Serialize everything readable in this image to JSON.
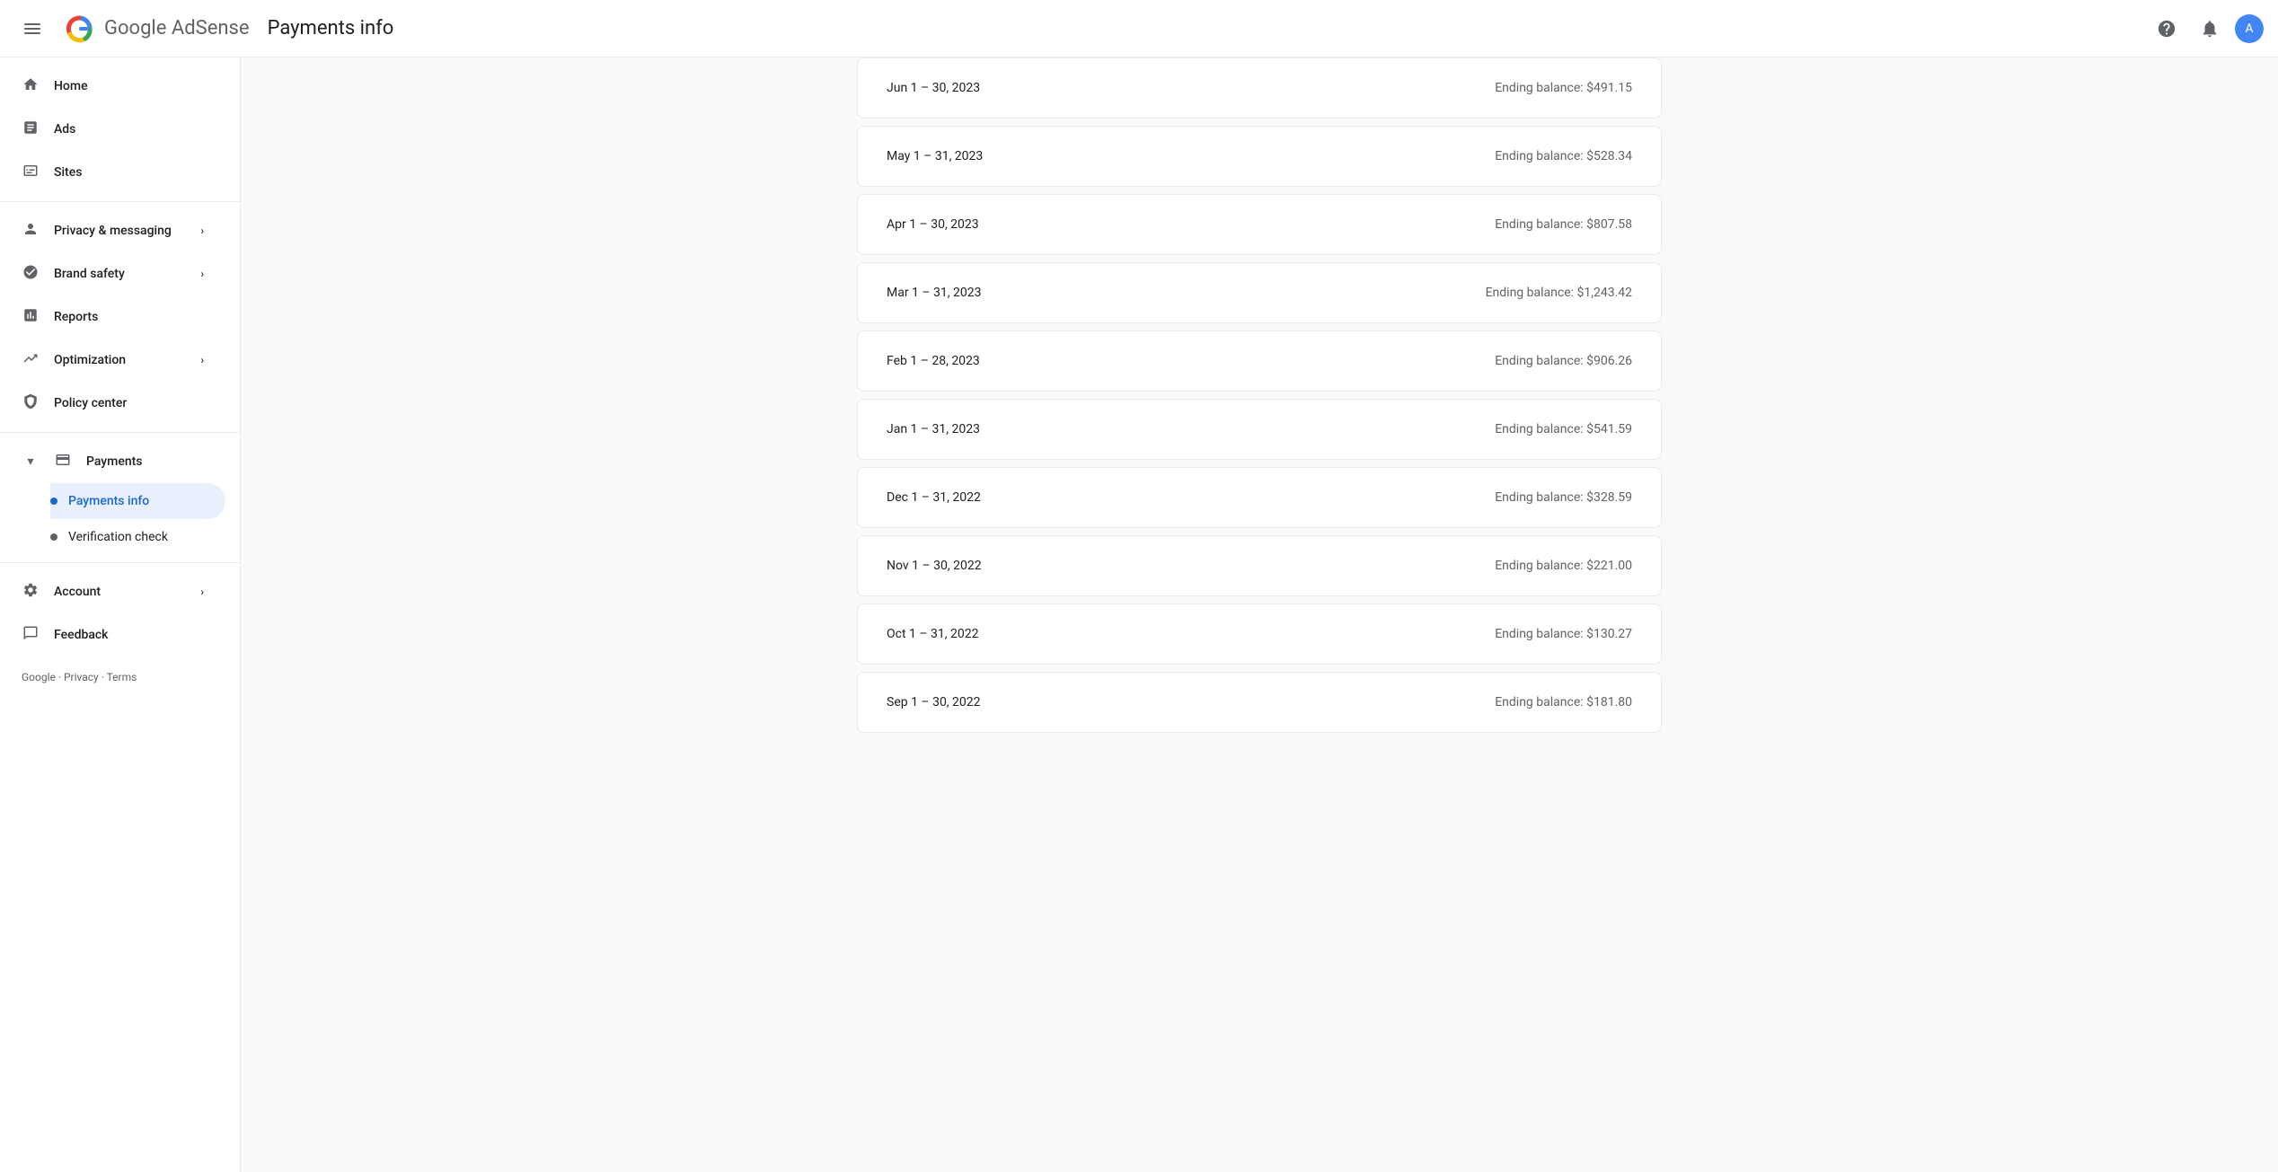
{
  "topbar": {
    "page_title": "Payments info",
    "help_icon": "?",
    "notifications_icon": "🔔",
    "avatar_initials": "A"
  },
  "sidebar": {
    "logo_text": "Google AdSense",
    "items": [
      {
        "id": "home",
        "label": "Home",
        "icon": "home",
        "active": false
      },
      {
        "id": "ads",
        "label": "Ads",
        "icon": "ads",
        "active": false
      },
      {
        "id": "sites",
        "label": "Sites",
        "icon": "sites",
        "active": false
      },
      {
        "id": "privacy-messaging",
        "label": "Privacy & messaging",
        "icon": "person",
        "active": false,
        "has_chevron": true
      },
      {
        "id": "brand-safety",
        "label": "Brand safety",
        "icon": "block",
        "active": false,
        "has_chevron": true
      },
      {
        "id": "reports",
        "label": "Reports",
        "icon": "bar_chart",
        "active": false
      },
      {
        "id": "optimization",
        "label": "Optimization",
        "icon": "trending_up",
        "active": false,
        "has_chevron": true
      },
      {
        "id": "policy-center",
        "label": "Policy center",
        "icon": "policy",
        "active": false
      }
    ],
    "payments_section": {
      "label": "Payments",
      "icon": "payments",
      "expanded": true,
      "sub_items": [
        {
          "id": "payments-info",
          "label": "Payments info",
          "active": true
        },
        {
          "id": "verification-check",
          "label": "Verification check",
          "active": false
        }
      ]
    },
    "account": {
      "label": "Account",
      "icon": "settings",
      "has_chevron": true
    },
    "feedback": {
      "label": "Feedback",
      "icon": "feedback"
    },
    "footer": "Google · Privacy · Terms"
  },
  "main": {
    "payment_rows": [
      {
        "date": "Jun 1 – 30, 2023",
        "balance": "Ending balance: $491.15"
      },
      {
        "date": "May 1 – 31, 2023",
        "balance": "Ending balance: $528.34"
      },
      {
        "date": "Apr 1 – 30, 2023",
        "balance": "Ending balance: $807.58"
      },
      {
        "date": "Mar 1 – 31, 2023",
        "balance": "Ending balance: $1,243.42"
      },
      {
        "date": "Feb 1 – 28, 2023",
        "balance": "Ending balance: $906.26"
      },
      {
        "date": "Jan 1 – 31, 2023",
        "balance": "Ending balance: $541.59"
      },
      {
        "date": "Dec 1 – 31, 2022",
        "balance": "Ending balance: $328.59"
      },
      {
        "date": "Nov 1 – 30, 2022",
        "balance": "Ending balance: $221.00"
      },
      {
        "date": "Oct 1 – 31, 2022",
        "balance": "Ending balance: $130.27"
      },
      {
        "date": "Sep 1 – 30, 2022",
        "balance": "Ending balance: $181.80"
      }
    ]
  }
}
